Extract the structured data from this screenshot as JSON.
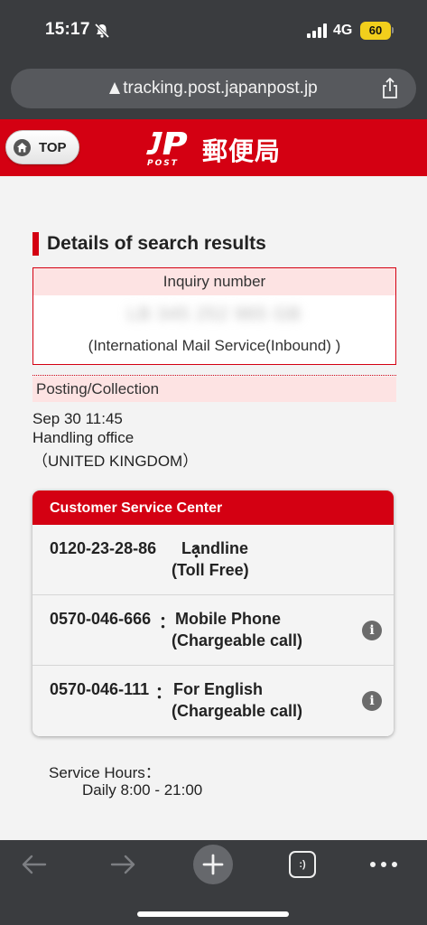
{
  "status_bar": {
    "time": "15:17",
    "network": "4G",
    "battery": "60",
    "battery_color": "#f2cf1c"
  },
  "browser": {
    "url": "tracking.post.japanpost.jp"
  },
  "header": {
    "top_button_label": "TOP",
    "logo_text": "POST",
    "site_title": "郵便局",
    "brand_color": "#d40012"
  },
  "results": {
    "heading": "Details of search results",
    "inquiry_label": "Inquiry number",
    "inquiry_number": "LB 345 252 965 GB",
    "inquiry_service": "(International Mail Service(Inbound) )",
    "posting_label": "Posting/Collection",
    "posting_date": "Sep 30 11:45",
    "posting_office": "Handling office",
    "posting_country": "（UNITED KINGDOM）"
  },
  "customer_service": {
    "title": "Customer Service Center",
    "rows": [
      {
        "number": "0120-23-28-86",
        "separator": "：",
        "type": "Landline",
        "sub": "(Toll Free)",
        "info_icon": false
      },
      {
        "number": "0570-046-666",
        "separator": "：",
        "type": "Mobile Phone",
        "sub": "(Chargeable call)",
        "info_icon": true
      },
      {
        "number": "0570-046-111",
        "separator": "：",
        "type": "For English",
        "sub": "(Chargeable call)",
        "info_icon": true
      }
    ],
    "hours_label": "Service Hours：",
    "hours_value": "Daily 8:00 - 21:00"
  },
  "toolbar": {
    "tabs_label": ":)",
    "icons": [
      "back-arrow-icon",
      "forward-arrow-icon",
      "plus-icon",
      "tabs-icon",
      "more-icon"
    ]
  }
}
